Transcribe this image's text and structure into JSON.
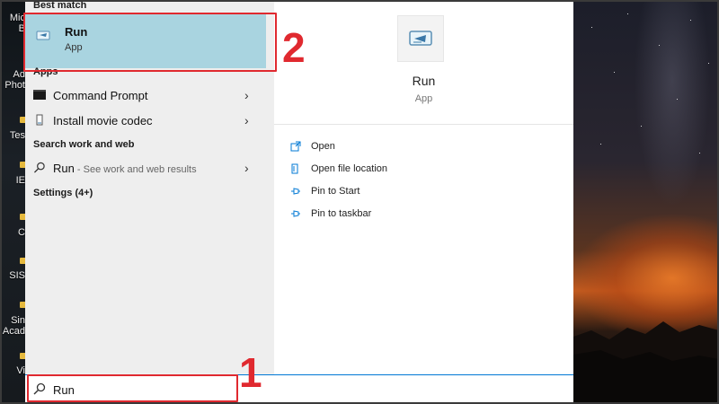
{
  "desktop": {
    "icons": [
      {
        "label": "Mic"
      },
      {
        "label": "B"
      },
      {
        "label": "Ad"
      },
      {
        "label": "Phot"
      },
      {
        "label": "Tes"
      },
      {
        "label": "IE"
      },
      {
        "label": "C"
      },
      {
        "label": "SIS"
      },
      {
        "label": "Sin"
      },
      {
        "label": "Acad"
      },
      {
        "label": "Vi"
      }
    ]
  },
  "start_menu": {
    "best_match": {
      "section_label": "Best match",
      "title": "Run",
      "subtitle": "App",
      "icon": "run-app-icon"
    },
    "apps": {
      "section_label": "Apps",
      "items": [
        {
          "label": "Command Prompt",
          "icon": "command-prompt-icon"
        },
        {
          "label": "Install movie codec",
          "icon": "document-icon"
        }
      ]
    },
    "search_web": {
      "section_label": "Search work and web",
      "item": {
        "label": "Run",
        "sub": " - See work and web results",
        "icon": "search-icon"
      }
    },
    "settings": {
      "section_label": "Settings (4+)"
    },
    "details": {
      "app_name": "Run",
      "app_type": "App",
      "actions": [
        {
          "label": "Open",
          "icon": "open-icon"
        },
        {
          "label": "Open file location",
          "icon": "file-location-icon"
        },
        {
          "label": "Pin to Start",
          "icon": "pin-icon"
        },
        {
          "label": "Pin to taskbar",
          "icon": "pin-icon"
        }
      ]
    },
    "search_box": {
      "value": "Run"
    }
  },
  "annotations": {
    "step_1": "1",
    "step_2": "2",
    "color": "#e0292f"
  },
  "colors": {
    "accent": "#0078d4",
    "selected_row": "#a9d4e0"
  }
}
